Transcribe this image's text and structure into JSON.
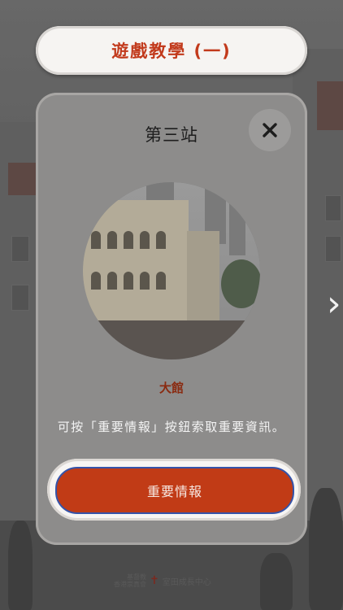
{
  "header": {
    "title": "遊戲教學 (一)"
  },
  "card": {
    "station": "第三站",
    "place_name": "大館",
    "close_icon": "close-icon"
  },
  "instruction": "可按「重要情報」按鈕索取重要資訊。",
  "cta": {
    "label": "重要情報"
  },
  "navigation": {
    "next_icon": "chevron-right-icon"
  },
  "footer": {
    "org_line1": "基督教",
    "org_line2": "香港崇真會",
    "center": "室田成長中心"
  },
  "colors": {
    "accent": "#c23a1c",
    "cta_bg": "#c13b16",
    "cta_border": "#3553a8",
    "place_name": "#8a2a10"
  }
}
